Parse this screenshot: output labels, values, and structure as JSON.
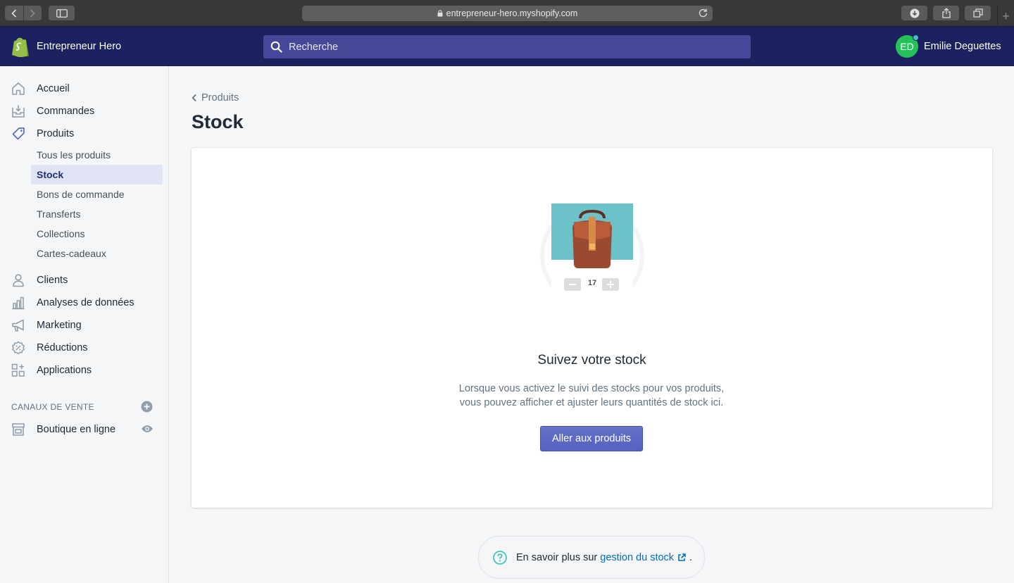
{
  "browser": {
    "url": "entrepreneur-hero.myshopify.com"
  },
  "topbar": {
    "store_name": "Entrepreneur Hero",
    "search_placeholder": "Recherche",
    "user_initials": "ED",
    "user_name": "Emilie Deguettes"
  },
  "sidebar": {
    "items": [
      {
        "label": "Accueil",
        "icon": "home-icon"
      },
      {
        "label": "Commandes",
        "icon": "orders-icon"
      },
      {
        "label": "Produits",
        "icon": "tag-icon"
      },
      {
        "label": "Clients",
        "icon": "user-icon"
      },
      {
        "label": "Analyses de données",
        "icon": "chart-icon"
      },
      {
        "label": "Marketing",
        "icon": "megaphone-icon"
      },
      {
        "label": "Réductions",
        "icon": "discount-icon"
      },
      {
        "label": "Applications",
        "icon": "apps-icon"
      }
    ],
    "product_subitems": [
      {
        "label": "Tous les produits"
      },
      {
        "label": "Stock",
        "active": true
      },
      {
        "label": "Bons de commande"
      },
      {
        "label": "Transferts"
      },
      {
        "label": "Collections"
      },
      {
        "label": "Cartes-cadeaux"
      }
    ],
    "channels_title": "CANAUX DE VENTE",
    "channels": [
      {
        "label": "Boutique en ligne",
        "icon": "store-icon"
      }
    ]
  },
  "main": {
    "breadcrumb": "Produits",
    "title": "Stock",
    "empty_state": {
      "illustration_quantity": "17",
      "heading": "Suivez votre stock",
      "text_line1": "Lorsque vous activez le suivi des stocks pour vos produits,",
      "text_line2": "vous pouvez afficher et ajuster leurs quantités de stock ici.",
      "button_label": "Aller aux produits"
    },
    "footer_help": {
      "prefix": "En savoir plus sur",
      "link": "gestion du stock",
      "suffix": "."
    }
  },
  "colors": {
    "topbar": "#1c2260",
    "search": "#47479a",
    "primary": "#5c6ac4",
    "avatar": "#23c35a",
    "link": "#006fbb"
  }
}
